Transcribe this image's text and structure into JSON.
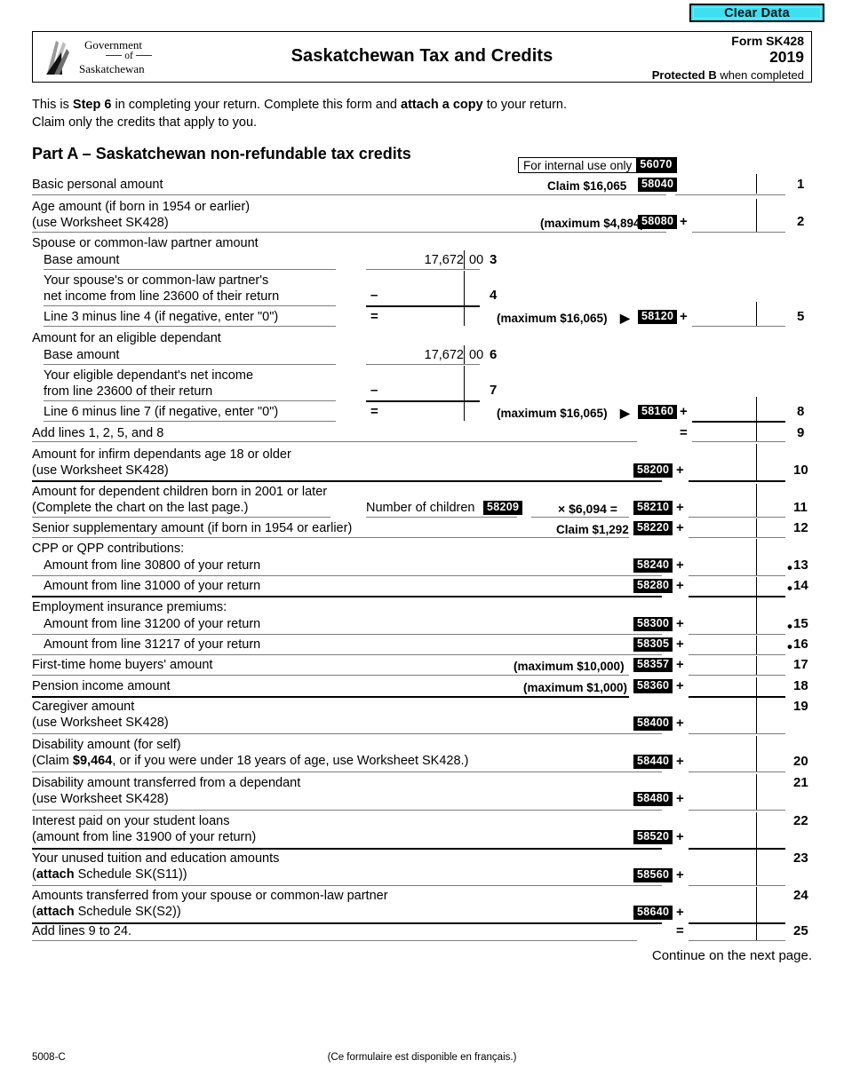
{
  "toolbar": {
    "clear_data_label": "Clear Data",
    "clear_data_color": "#3fdff2"
  },
  "header": {
    "logo_line1": "Government",
    "logo_line2": "of",
    "logo_line3": "Saskatchewan",
    "title": "Saskatchewan Tax and Credits",
    "form_number": "Form SK428",
    "year": "2019",
    "protected_bold": "Protected B",
    "protected_rest": " when completed"
  },
  "intro": {
    "line1_a": "This is ",
    "line1_b": "Step 6",
    "line1_c": " in completing your return. Complete this form and ",
    "line1_d": "attach a copy",
    "line1_e": " to your return.",
    "line2": "Claim only the credits that apply to you."
  },
  "part_a": {
    "heading": "Part A – Saskatchewan non-refundable tax credits",
    "internal_use_label": "For internal use only",
    "internal_use_code": "56070"
  },
  "rows": {
    "r1": {
      "label": "Basic personal amount",
      "claim": "Claim $16,065",
      "code": "58040",
      "line": "1"
    },
    "r2": {
      "label1": "Age amount (if born in 1954 or earlier)",
      "label2": "(use Worksheet SK428)",
      "max": "(maximum $4,894)",
      "code": "58080",
      "op": "+",
      "line": "2"
    },
    "spouse": {
      "heading": "Spouse or common-law partner amount",
      "base_label": "Base amount",
      "base_value_dollars": "17,672",
      "base_value_cents": "00",
      "base_line": "3",
      "net_label1": "Your spouse's or common-law partner's",
      "net_label2": "net income from line 23600 of their return",
      "net_op": "–",
      "net_line": "4",
      "result_label": "Line 3 minus line 4 (if negative, enter \"0\")",
      "result_op": "=",
      "max": "(maximum $16,065)",
      "arrow": "▶",
      "code": "58120",
      "op": "+",
      "line": "5"
    },
    "dependant": {
      "heading": "Amount for an eligible dependant",
      "base_label": "Base amount",
      "base_value_dollars": "17,672",
      "base_value_cents": "00",
      "base_line": "6",
      "net_label1": "Your eligible dependant's net income",
      "net_label2": "from line 23600 of their return",
      "net_op": "–",
      "net_line": "7",
      "result_label": "Line 6 minus line 7 (if negative, enter \"0\")",
      "result_op": "=",
      "max": "(maximum $16,065)",
      "arrow": "▶",
      "code": "58160",
      "op": "+",
      "line": "8"
    },
    "r9": {
      "label": "Add lines 1, 2, 5, and 8",
      "op": "=",
      "line": "9"
    },
    "r10": {
      "label1": "Amount for infirm dependants age 18 or older",
      "label2": "(use Worksheet SK428)",
      "code": "58200",
      "op": "+",
      "line": "10"
    },
    "r11": {
      "label1": "Amount for dependent children born in 2001 or later",
      "label2": "(Complete the chart on the last page.)",
      "children_label": "Number of children",
      "children_code": "58209",
      "multiplier": "× $6,094 =",
      "code": "58210",
      "op": "+",
      "line": "11"
    },
    "r12": {
      "label": "Senior supplementary amount (if born in 1954 or earlier)",
      "claim": "Claim $1,292",
      "code": "58220",
      "op": "+",
      "line": "12"
    },
    "cpp_heading": "CPP or QPP contributions:",
    "r13": {
      "label": "Amount from line 30800 of your return",
      "code": "58240",
      "op": "+",
      "line": "13",
      "bullet": true
    },
    "r14": {
      "label": "Amount from line 31000 of your return",
      "code": "58280",
      "op": "+",
      "line": "14",
      "bullet": true
    },
    "ei_heading": "Employment insurance premiums:",
    "r15": {
      "label": "Amount from line 31200 of your return",
      "code": "58300",
      "op": "+",
      "line": "15",
      "bullet": true
    },
    "r16": {
      "label": "Amount from line 31217 of your return",
      "code": "58305",
      "op": "+",
      "line": "16",
      "bullet": true
    },
    "r17": {
      "label": "First-time home buyers' amount",
      "max": "(maximum $10,000)",
      "code": "58357",
      "op": "+",
      "line": "17"
    },
    "r18": {
      "label": "Pension income amount",
      "max": "(maximum $1,000)",
      "code": "58360",
      "op": "+",
      "line": "18"
    },
    "r19": {
      "label1": "Caregiver amount",
      "label2": "(use Worksheet SK428)",
      "code": "58400",
      "op": "+",
      "line": "19"
    },
    "r20": {
      "label1": "Disability amount (for self)",
      "label2_a": "(Claim ",
      "label2_b": "$9,464",
      "label2_c": ", or if you were under 18 years of age, use Worksheet SK428.)",
      "code": "58440",
      "op": "+",
      "line": "20"
    },
    "r21": {
      "label1": "Disability amount transferred from a dependant",
      "label2": "(use Worksheet SK428)",
      "code": "58480",
      "op": "+",
      "line": "21"
    },
    "r22": {
      "label1": "Interest paid on your student loans",
      "label2": "(amount from line 31900 of your return)",
      "code": "58520",
      "op": "+",
      "line": "22"
    },
    "r23": {
      "label1": "Your unused tuition and education amounts",
      "label2_a": "(",
      "label2_b": "attach",
      "label2_c": " Schedule SK(S11))",
      "code": "58560",
      "op": "+",
      "line": "23"
    },
    "r24": {
      "label1": "Amounts transferred from your spouse or common-law partner",
      "label2_a": "(",
      "label2_b": "attach",
      "label2_c": " Schedule SK(S2))",
      "code": "58640",
      "op": "+",
      "line": "24"
    },
    "r25": {
      "label": "Add lines 9 to 24.",
      "op": "=",
      "line": "25"
    }
  },
  "footer": {
    "continue": "Continue on the next page.",
    "form_code": "5008-C",
    "french_note": "(Ce formulaire est disponible en français.)"
  }
}
